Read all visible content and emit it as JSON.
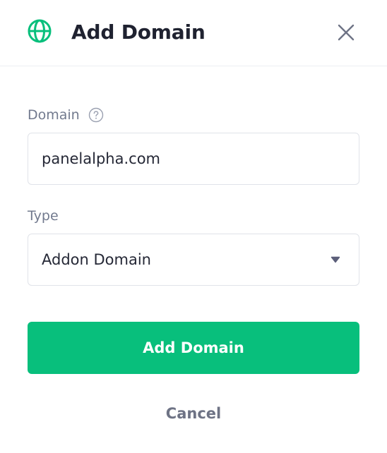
{
  "header": {
    "title": "Add Domain",
    "icon": "globe-icon",
    "close_icon": "close-icon"
  },
  "form": {
    "domain": {
      "label": "Domain",
      "help_icon": "question-circle-icon",
      "value": "panelalpha.com"
    },
    "type": {
      "label": "Type",
      "selected": "Addon Domain",
      "dropdown_icon": "caret-down-icon"
    }
  },
  "actions": {
    "submit_label": "Add Domain",
    "cancel_label": "Cancel"
  },
  "colors": {
    "accent": "#08bf7c",
    "title": "#1f2230",
    "label": "#727a8e",
    "border": "#e0e3e9"
  }
}
